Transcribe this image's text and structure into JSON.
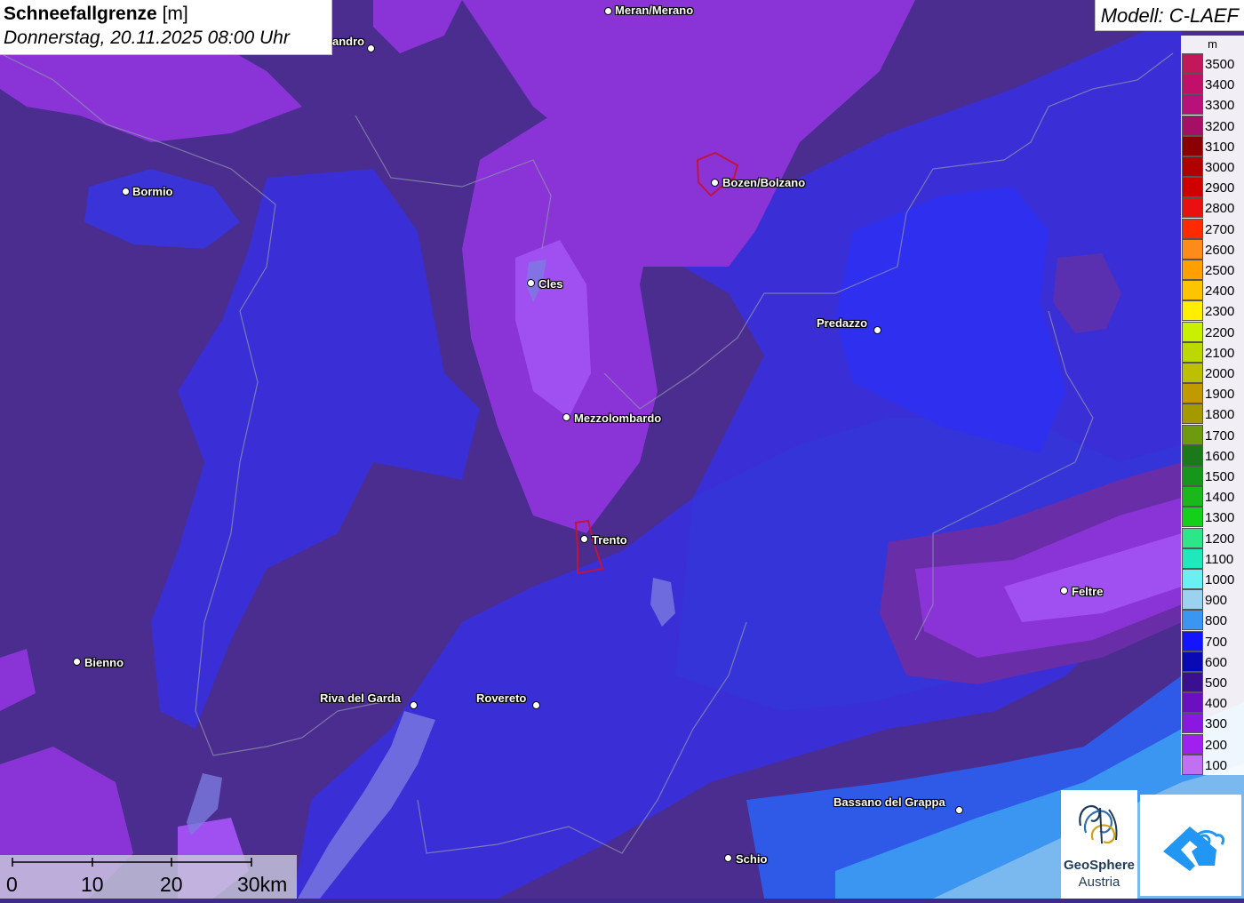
{
  "title": {
    "parameter": "Schneefallgrenze",
    "unit": "[m]",
    "datetime": "Donnerstag, 20.11.2025 08:00 Uhr"
  },
  "model_label": "Modell: C-LAEF",
  "legend": {
    "unit": "m",
    "entries": [
      {
        "label": "3500",
        "color": "#c2185b"
      },
      {
        "label": "3400",
        "color": "#c2106a"
      },
      {
        "label": "3300",
        "color": "#b8117a"
      },
      {
        "label": "3200",
        "color": "#a50f66"
      },
      {
        "label": "3100",
        "color": "#8b0000"
      },
      {
        "label": "3000",
        "color": "#b00000"
      },
      {
        "label": "2900",
        "color": "#d00000"
      },
      {
        "label": "2800",
        "color": "#e81010"
      },
      {
        "label": "2700",
        "color": "#ff2a00"
      },
      {
        "label": "2600",
        "color": "#ff8c1a"
      },
      {
        "label": "2500",
        "color": "#ffa000"
      },
      {
        "label": "2400",
        "color": "#ffc400"
      },
      {
        "label": "2300",
        "color": "#ffee00"
      },
      {
        "label": "2200",
        "color": "#c8f000"
      },
      {
        "label": "2100",
        "color": "#bcd800"
      },
      {
        "label": "2000",
        "color": "#bcc000"
      },
      {
        "label": "1900",
        "color": "#c09a00"
      },
      {
        "label": "1800",
        "color": "#a49a00"
      },
      {
        "label": "1700",
        "color": "#6e9a10"
      },
      {
        "label": "1600",
        "color": "#1a7a1a"
      },
      {
        "label": "1500",
        "color": "#16961a"
      },
      {
        "label": "1400",
        "color": "#1ab81a"
      },
      {
        "label": "1300",
        "color": "#14d01a"
      },
      {
        "label": "1200",
        "color": "#2ee68a"
      },
      {
        "label": "1100",
        "color": "#1ee8bc"
      },
      {
        "label": "1000",
        "color": "#6af0f0"
      },
      {
        "label": "900",
        "color": "#9ad2f0"
      },
      {
        "label": "800",
        "color": "#3a96f0"
      },
      {
        "label": "700",
        "color": "#1414ff"
      },
      {
        "label": "600",
        "color": "#0a0ab4"
      },
      {
        "label": "500",
        "color": "#3a1090"
      },
      {
        "label": "400",
        "color": "#6a10c0"
      },
      {
        "label": "300",
        "color": "#8a18e0"
      },
      {
        "label": "200",
        "color": "#a020f0"
      },
      {
        "label": "100",
        "color": "#c070f0"
      }
    ]
  },
  "cities": [
    {
      "name": "Meran/Merano"
    },
    {
      "name": "andro"
    },
    {
      "name": "Bormio"
    },
    {
      "name": "Bozen/Bolzano"
    },
    {
      "name": "Cles"
    },
    {
      "name": "Predazzo"
    },
    {
      "name": "Mezzolombardo"
    },
    {
      "name": "Trento"
    },
    {
      "name": "Feltre"
    },
    {
      "name": "Bienno"
    },
    {
      "name": "Riva del Garda"
    },
    {
      "name": "Rovereto"
    },
    {
      "name": "Bassano del Grappa"
    },
    {
      "name": "Schio"
    }
  ],
  "scale_bar": {
    "labels": [
      "0",
      "10",
      "20",
      "30km"
    ]
  },
  "logos": {
    "geosphere_line1": "GeoSphere",
    "geosphere_line2": "Austria",
    "app_icon": "cloud-arrow-icon"
  }
}
